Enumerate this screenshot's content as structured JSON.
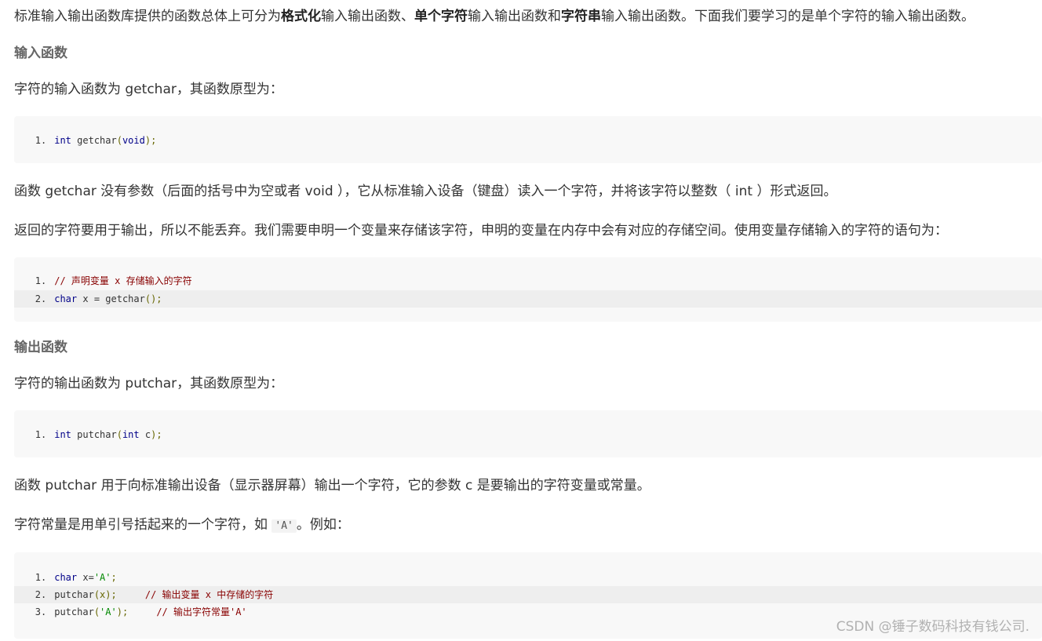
{
  "intro": {
    "t1": "标准输入输出函数库提供的函数总体上可分为",
    "b1": "格式化",
    "t2": "输入输出函数、",
    "b2": "单个字符",
    "t3": "输入输出函数和",
    "b3": "字符串",
    "t4": "输入输出函数。下面我们要学习的是单个字符的输入输出函数。"
  },
  "input_section": {
    "heading": "输入函数",
    "proto_text": "字符的输入函数为 getchar，其函数原型为：",
    "code1": [
      {
        "num": "1",
        "tokens": {
          "kw": "int",
          "rest": " getchar",
          "p1": "(",
          "kw2": "void",
          "p2": ");"
        }
      }
    ],
    "desc": "函数 getchar 没有参数（后面的括号中为空或者 void ），它从标准输入设备（键盘）读入一个字符，并将该字符以整数（ int ）形式返回。",
    "desc2": "返回的字符要用于输出，所以不能丢弃。我们需要申明一个变量来存储该字符，申明的变量在内存中会有对应的存储空间。使用变量存储输入的字符的语句为：",
    "code2": {
      "line1_num": "1",
      "line1_comment": "// 声明变量 x 存储输入的字符",
      "line2_num": "2",
      "line2_kw": "char",
      "line2_rest": " x = getchar",
      "line2_p": "();"
    }
  },
  "output_section": {
    "heading": "输出函数",
    "proto_text": "字符的输出函数为 putchar，其函数原型为：",
    "code1": {
      "num": "1",
      "kw": "int",
      "rest": " putchar",
      "p1": "(",
      "kw2": "int",
      "rest2": " c",
      "p2": ");"
    },
    "desc": "函数 putchar 用于向标准输出设备（显示器屏幕）输出一个字符，它的参数 c 是要输出的字符变量或常量。",
    "const_pre": "字符常量是用单引号括起来的一个字符，如 ",
    "const_code": "'A'",
    "const_post": "。例如：",
    "code2": {
      "l1_num": "1",
      "l1_kw": "char",
      "l1_rest": " x=",
      "l1_str": "'A'",
      "l1_p": ";",
      "l2_num": "2",
      "l2_rest": "putchar",
      "l2_p": "(x);",
      "l2_cm": "// 输出变量 x 中存储的字符",
      "l3_num": "3",
      "l3_rest": "putchar",
      "l3_p1": "(",
      "l3_str": "'A'",
      "l3_p2": ");",
      "l3_cm": "// 输出字符常量'A'"
    }
  },
  "watermark": "CSDN @锤子数码科技有钱公司."
}
